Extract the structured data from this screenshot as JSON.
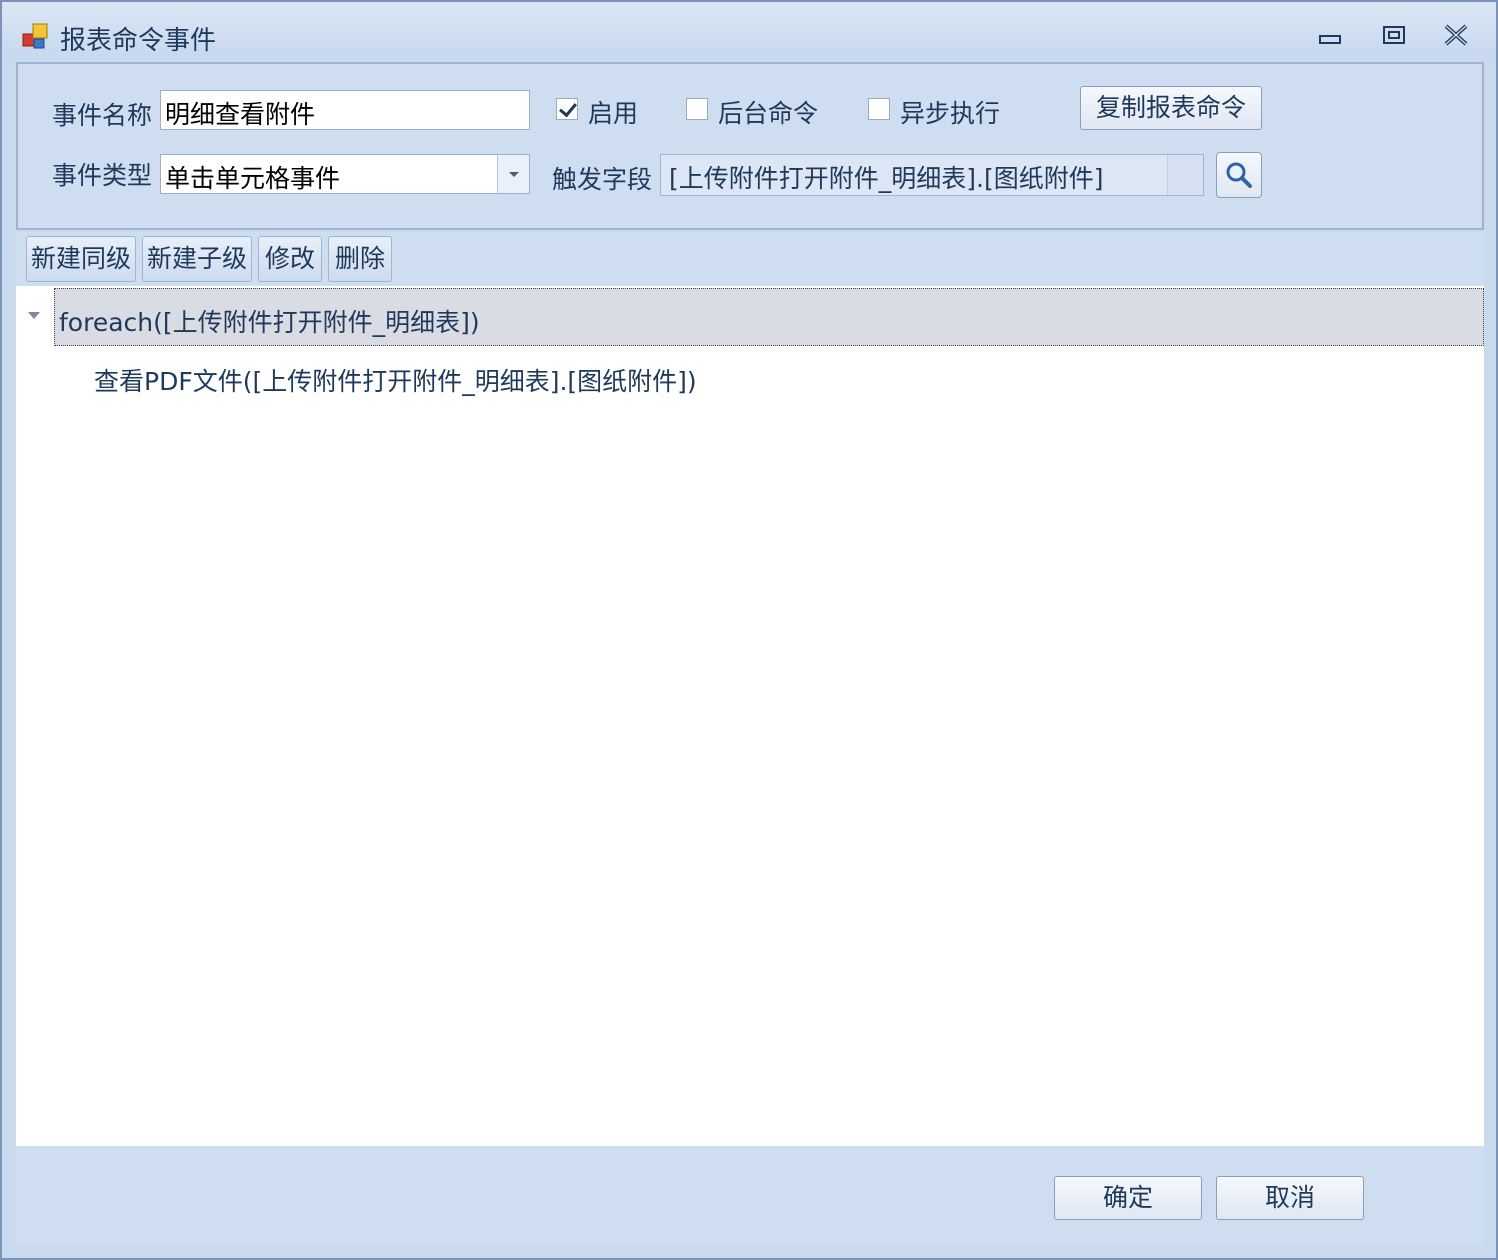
{
  "window": {
    "title": "报表命令事件",
    "controls": {
      "minimize": "minimize-icon",
      "maximize": "restore-icon",
      "close": "close-icon"
    }
  },
  "form": {
    "event_name_label": "事件名称",
    "event_name_value": "明细查看附件",
    "event_type_label": "事件类型",
    "event_type_value": "单击单元格事件",
    "enable_label": "启用",
    "enable_checked": true,
    "background_label": "后台命令",
    "background_checked": false,
    "async_label": "异步执行",
    "async_checked": false,
    "copy_button": "复制报表命令",
    "trigger_field_label": "触发字段",
    "trigger_field_value": "[上传附件打开附件_明细表].[图纸附件]"
  },
  "toolbar": {
    "new_sibling": "新建同级",
    "new_child": "新建子级",
    "edit": "修改",
    "delete": "删除"
  },
  "tree": {
    "nodes": [
      {
        "label": "foreach([上传附件打开附件_明细表])",
        "level": 0,
        "selected": true,
        "expanded": true
      },
      {
        "label": "查看PDF文件([上传附件打开附件_明细表].[图纸附件])",
        "level": 1,
        "selected": false
      }
    ]
  },
  "footer": {
    "ok": "确定",
    "cancel": "取消"
  },
  "colors": {
    "chrome": "#c9d9ee",
    "panel": "#cfddf0",
    "text": "#1e395b",
    "selection": "#dadce4"
  }
}
